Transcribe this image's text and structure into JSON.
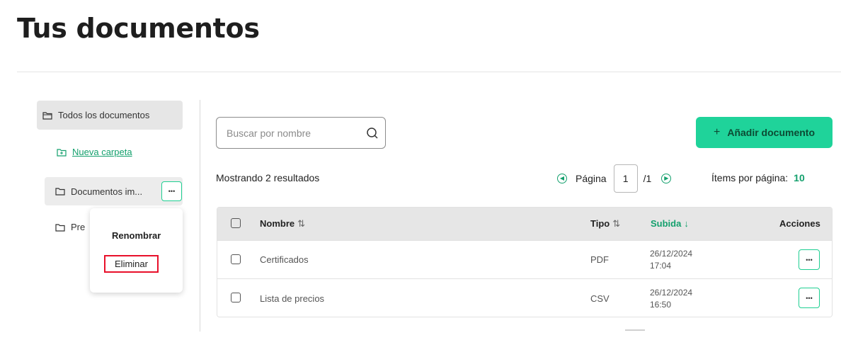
{
  "page": {
    "title": "Tus documentos"
  },
  "sidebar": {
    "all_documents": "Todos los documentos",
    "new_folder": "Nueva carpeta",
    "folders": [
      "Documentos im...",
      "Pre"
    ],
    "more_button": "•••"
  },
  "context_menu": {
    "rename": "Renombrar",
    "delete": "Eliminar"
  },
  "toolbar": {
    "search_placeholder": "Buscar por nombre",
    "add_button": "Añadir documento",
    "add_plus": "+"
  },
  "summary": {
    "results": "Mostrando 2 resultados",
    "page_label": "Página",
    "page_current": "1",
    "page_total": "/1",
    "items_per_page_label": "Ítems por página:",
    "items_per_page_value": "10"
  },
  "table": {
    "headers": {
      "name": "Nombre",
      "type": "Tipo",
      "uploaded": "Subida",
      "actions": "Acciones"
    },
    "sort_icons": {
      "name": "⇅",
      "type": "⇅",
      "uploaded": "↓"
    },
    "rows": [
      {
        "name": "Certificados",
        "type": "PDF",
        "date": "26/12/2024",
        "time": "17:04",
        "actions": "•••"
      },
      {
        "name": "Lista de precios",
        "type": "CSV",
        "date": "26/12/2024",
        "time": "16:50",
        "actions": "•••"
      }
    ]
  },
  "colors": {
    "accent": "#1fd39a",
    "accent_dark": "#14a06d",
    "highlight": "#e8102a"
  }
}
